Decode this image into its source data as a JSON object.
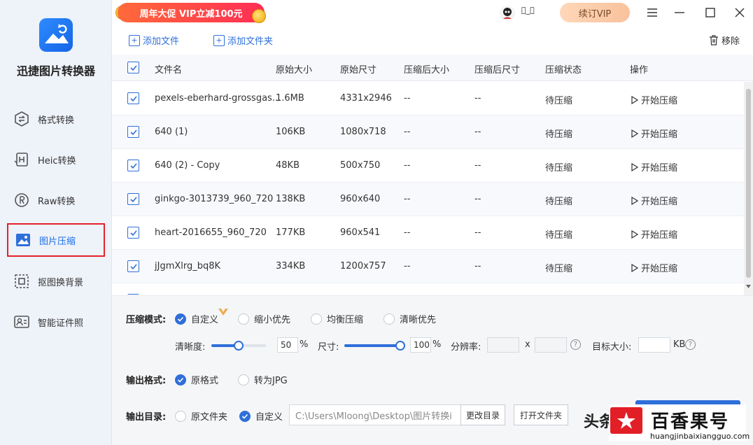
{
  "app": {
    "name": "迅捷图片转换器"
  },
  "sidebar": {
    "items": [
      {
        "label": "格式转换",
        "icon": "format-convert-icon"
      },
      {
        "label": "Heic转换",
        "icon": "heic-icon"
      },
      {
        "label": "Raw转换",
        "icon": "raw-icon"
      },
      {
        "label": "图片压缩",
        "icon": "image-compress-icon",
        "active": true
      },
      {
        "label": "抠图换背景",
        "icon": "cutout-icon"
      },
      {
        "label": "智能证件照",
        "icon": "id-photo-icon"
      }
    ]
  },
  "topbar": {
    "promo": "周年大促 VIP立减100元",
    "username": "\u0000_\u0000",
    "vip_button": "续订VIP"
  },
  "toolbar": {
    "add_file": "添加文件",
    "add_folder": "添加文件夹",
    "remove": "移除"
  },
  "table": {
    "columns": [
      "文件名",
      "原始大小",
      "原始尺寸",
      "压缩后大小",
      "压缩后尺寸",
      "压缩状态",
      "操作"
    ],
    "rows": [
      {
        "name": "pexels-eberhard-grossgas...",
        "size": "1.6MB",
        "dims": "4331x2946",
        "new_size": "--",
        "new_dims": "--",
        "status": "待压缩",
        "action": "开始压缩"
      },
      {
        "name": "640 (1)",
        "size": "106KB",
        "dims": "1080x718",
        "new_size": "--",
        "new_dims": "--",
        "status": "待压缩",
        "action": "开始压缩"
      },
      {
        "name": "640 (2) - Copy",
        "size": "48KB",
        "dims": "500x750",
        "new_size": "--",
        "new_dims": "--",
        "status": "待压缩",
        "action": "开始压缩"
      },
      {
        "name": "ginkgo-3013739_960_720",
        "size": "138KB",
        "dims": "960x640",
        "new_size": "--",
        "new_dims": "--",
        "status": "待压缩",
        "action": "开始压缩"
      },
      {
        "name": "heart-2016655_960_720",
        "size": "177KB",
        "dims": "960x541",
        "new_size": "--",
        "new_dims": "--",
        "status": "待压缩",
        "action": "开始压缩"
      },
      {
        "name": "jJgmXlrg_bq8K",
        "size": "334KB",
        "dims": "1200x757",
        "new_size": "--",
        "new_dims": "--",
        "status": "待压缩",
        "action": "开始压缩"
      }
    ]
  },
  "settings": {
    "mode_label": "压缩模式:",
    "modes": [
      "自定义",
      "缩小优先",
      "均衡压缩",
      "清晰优先"
    ],
    "mode_selected": 0,
    "clarity_label": "清晰度:",
    "clarity_value": "50",
    "clarity_fraction": 0.5,
    "size_label": "尺寸:",
    "size_value": "100",
    "size_fraction": 1.0,
    "percent": "%",
    "resolution_label": "分辨率:",
    "resolution_x": "x",
    "target_label": "目标大小:",
    "target_unit": "KB",
    "format_label": "输出格式:",
    "formats": [
      "原格式",
      "转为JPG"
    ],
    "format_selected": 0,
    "dir_label": "输出目录:",
    "dirs": [
      "原文件夹",
      "自定义"
    ],
    "dir_selected": 1,
    "path": "C:\\Users\\Mloong\\Desktop\\图片转换i",
    "change_dir": "更改目录",
    "open_folder": "打开文件夹"
  },
  "watermark": {
    "toutiao": "头条",
    "title": "百香果号",
    "url": "huangjinbaixiangguo.com"
  }
}
